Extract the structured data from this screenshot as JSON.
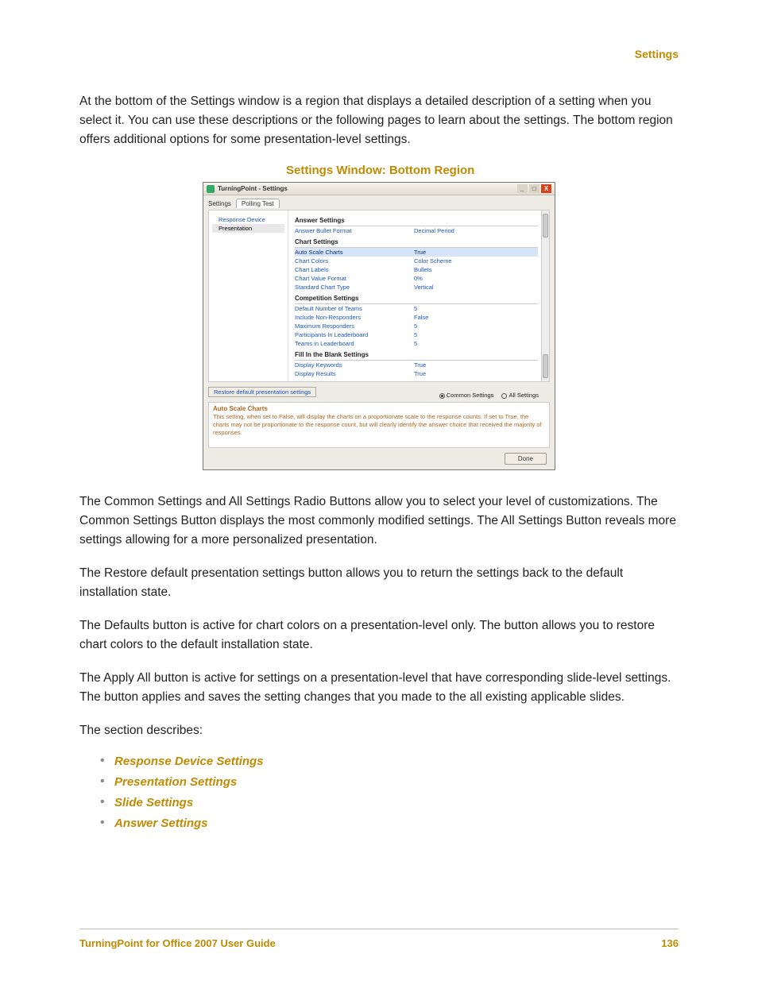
{
  "header": {
    "section": "Settings"
  },
  "intro": {
    "p1": "At the bottom of the Settings window is a region that displays a detailed description of a setting when you select it. You can use these descriptions or the following pages to learn about the settings. The bottom region offers additional options for some presentation-level settings."
  },
  "figure": {
    "title": "Settings Window: Bottom Region",
    "window_title": "TurningPoint - Settings",
    "tabs": {
      "prefix": "Settings",
      "active": "Polling Test"
    },
    "nav": {
      "items": [
        "Response Device",
        "Presentation"
      ],
      "selected_index": 1
    },
    "sections": {
      "answer": {
        "heading": "Answer Settings",
        "rows": [
          {
            "label": "Answer Bullet Format",
            "value": "Decimal Period"
          }
        ]
      },
      "chart": {
        "heading": "Chart Settings",
        "rows": [
          {
            "label": "Auto Scale Charts",
            "value": "True",
            "selected": true
          },
          {
            "label": "Chart Colors",
            "value": "Color Scheme"
          },
          {
            "label": "Chart Labels",
            "value": "Bullets"
          },
          {
            "label": "Chart Value Format",
            "value": "0%"
          },
          {
            "label": "Standard Chart Type",
            "value": "Vertical"
          }
        ]
      },
      "competition": {
        "heading": "Competition Settings",
        "rows": [
          {
            "label": "Default Number of Teams",
            "value": "5"
          },
          {
            "label": "Include Non-Responders",
            "value": "False"
          },
          {
            "label": "Maximum Responders",
            "value": "5"
          },
          {
            "label": "Participants In Leaderboard",
            "value": "5"
          },
          {
            "label": "Teams in Leaderboard",
            "value": "5"
          }
        ]
      },
      "fitb": {
        "heading": "Fill In the Blank Settings",
        "rows": [
          {
            "label": "Display Keywords",
            "value": "True"
          },
          {
            "label": "Display Results",
            "value": "True"
          }
        ]
      }
    },
    "restore_button": "Restore default presentation settings",
    "radios": {
      "common": "Common Settings",
      "all": "All Settings",
      "selected": "common"
    },
    "description": {
      "heading": "Auto Scale Charts",
      "text": "This setting, when set to False, will display the charts on a proportionate scale to the response counts. If set to True, the charts may not be proportionate to the response count, but will clearly identify the answer choice that received the majority of responses."
    },
    "done": "Done"
  },
  "paragraphs": {
    "p2": "The Common Settings and All Settings Radio Buttons allow you to select your level of customizations. The Common Settings Button displays the most commonly modified settings. The All Settings Button reveals more settings allowing for a more personalized presentation.",
    "p3": "The Restore default presentation settings button allows you to return the settings back to the default installation state.",
    "p4": "The Defaults button is active for chart colors on a presentation-level only. The button allows you to restore chart colors to the default installation state.",
    "p5": "The Apply All button is active for settings on a presentation-level that have corresponding slide-level settings. The button applies and saves the setting changes that you made to the all existing applicable slides.",
    "p6": "The section describes:"
  },
  "links": [
    "Response Device Settings",
    "Presentation Settings",
    "Slide Settings",
    "Answer Settings"
  ],
  "footer": {
    "left": "TurningPoint for Office 2007 User Guide",
    "right": "136"
  }
}
